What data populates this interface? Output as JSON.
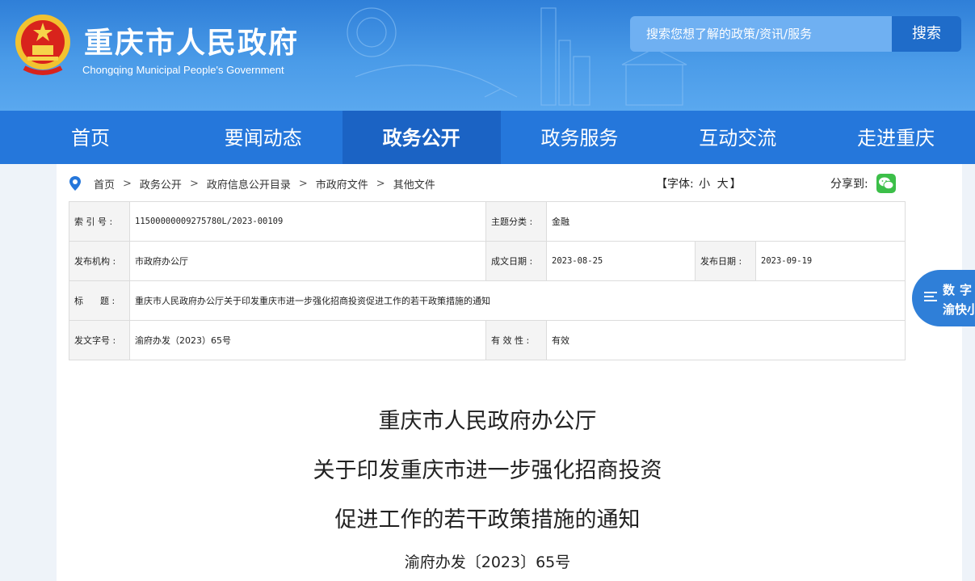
{
  "header": {
    "title": "重庆市人民政府",
    "subtitle": "Chongqing Municipal People's Government",
    "search_placeholder": "搜索您想了解的政策/资讯/服务",
    "search_button": "搜索"
  },
  "nav": {
    "items": [
      {
        "label": "首页",
        "active": false
      },
      {
        "label": "要闻动态",
        "active": false
      },
      {
        "label": "政务公开",
        "active": true
      },
      {
        "label": "政务服务",
        "active": false
      },
      {
        "label": "互动交流",
        "active": false
      },
      {
        "label": "走进重庆",
        "active": false
      }
    ]
  },
  "breadcrumb": [
    "首页",
    "政务公开",
    "政府信息公开目录",
    "市政府文件",
    "其他文件"
  ],
  "font_control": {
    "prefix": "【字体:",
    "small": "小",
    "large": "大",
    "suffix": "】"
  },
  "share": {
    "label": "分享到:"
  },
  "meta": {
    "index_label": "索 引 号 :",
    "index_value": "11500000009275780L/2023-00109",
    "topic_label": "主题分类 :",
    "topic_value": "金融",
    "publisher_label": "发布机构 :",
    "publisher_value": "市政府办公厅",
    "written_label": "成文日期 :",
    "written_value": "2023-08-25",
    "published_label": "发布日期 :",
    "published_value": "2023-09-19",
    "title_label": "标      题 :",
    "title_value": "重庆市人民政府办公厅关于印发重庆市进一步强化招商投资促进工作的若干政策措施的通知",
    "docno_label": "发文字号 :",
    "docno_value": "渝府办发（2023）65号",
    "validity_label": "有 效 性 :",
    "validity_value": "有效"
  },
  "document": {
    "title_line1": "重庆市人民政府办公厅",
    "title_line2": "关于印发重庆市进一步强化招商投资",
    "title_line3": "促进工作的若干政策措施的通知",
    "doc_number": "渝府办发〔2023〕65号"
  },
  "float_widget": {
    "line1": "数字",
    "line2": "渝快小"
  },
  "colors": {
    "primary": "#2577db",
    "header": "#2f7fd8",
    "wechat": "#3cbf49"
  }
}
